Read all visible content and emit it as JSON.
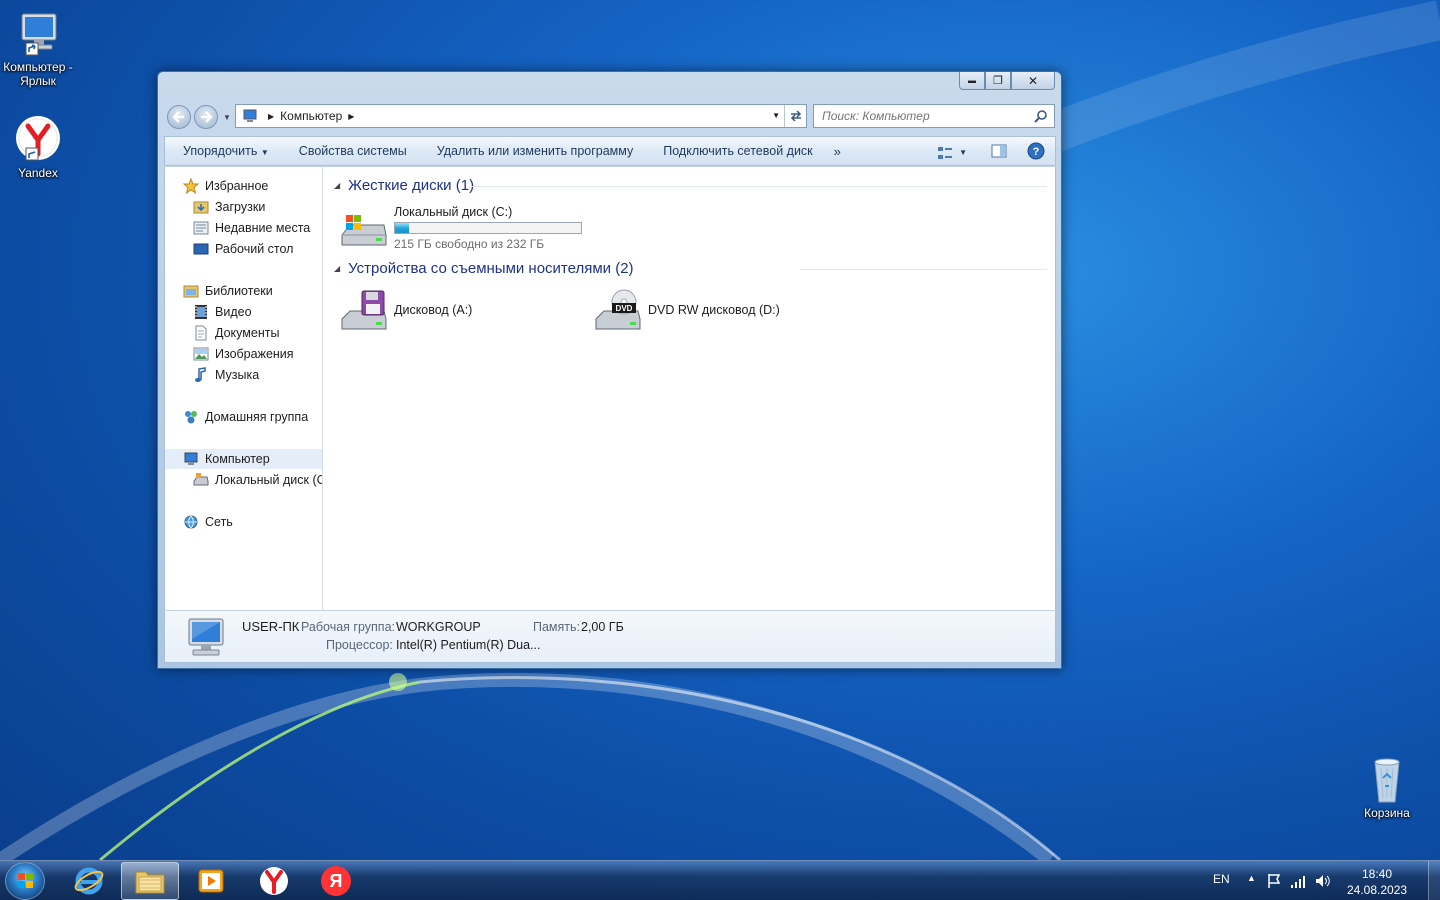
{
  "desktop": {
    "icons": [
      {
        "label": "Компьютер - Ярлык"
      },
      {
        "label": "Yandex"
      },
      {
        "label": "Корзина"
      }
    ]
  },
  "window": {
    "caption": {
      "minimize": "▬",
      "maximize": "❐",
      "close": "✕"
    },
    "address": {
      "crumb": "Компьютер"
    },
    "search": {
      "placeholder": "Поиск: Компьютер"
    },
    "toolbar": {
      "organize": "Упорядочить",
      "system_properties": "Свойства системы",
      "uninstall": "Удалить или изменить программу",
      "map_drive": "Подключить сетевой диск",
      "more": "»"
    },
    "nav": {
      "favorites": "Избранное",
      "downloads": "Загрузки",
      "recent": "Недавние места",
      "desktop": "Рабочий стол",
      "libraries": "Библиотеки",
      "video": "Видео",
      "documents": "Документы",
      "images": "Изображения",
      "music": "Музыка",
      "homegroup": "Домашняя группа",
      "computer": "Компьютер",
      "local_disk": "Локальный диск (C",
      "network": "Сеть"
    },
    "groups": {
      "hard_drives": "Жесткие диски (1)",
      "removable": "Устройства со съемными носителями (2)"
    },
    "drives": {
      "c_name": "Локальный диск (C:)",
      "c_free": "215 ГБ свободно из 232 ГБ",
      "c_used_fraction": 0.073,
      "a_name": "Дисковод (A:)",
      "d_name": "DVD RW дисковод (D:)",
      "dvd_badge": "DVD"
    },
    "details": {
      "pc_name": "USER-ПК",
      "workgroup_label": "Рабочая группа:",
      "workgroup_value": "WORKGROUP",
      "memory_label": "Память:",
      "memory_value": "2,00 ГБ",
      "cpu_label": "Процессор:",
      "cpu_value": "Intel(R) Pentium(R) Dua..."
    }
  },
  "taskbar": {
    "lang": "EN",
    "time": "18:40",
    "date": "24.08.2023",
    "yandex_letter": "Я"
  }
}
